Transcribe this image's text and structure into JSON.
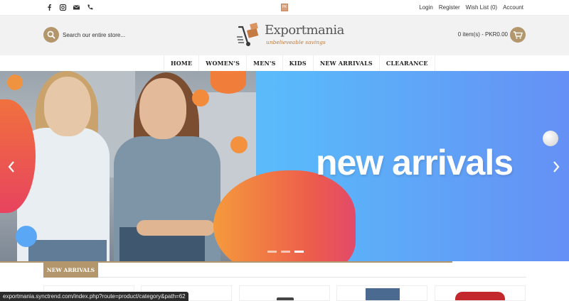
{
  "topbar": {
    "social_icons": [
      "facebook-icon",
      "instagram-icon",
      "email-icon",
      "phone-icon"
    ],
    "links": [
      "Login",
      "Register",
      "Wish List (0)",
      "Account"
    ]
  },
  "header": {
    "search_placeholder": "Search our entire store...",
    "logo_title": "Exportmania",
    "logo_tagline": "unbelieveable savings",
    "cart_text": "0 item(s) - PKR0.00"
  },
  "nav": {
    "items": [
      "HOME",
      "WOMEN'S",
      "MEN'S",
      "KIDS",
      "NEW ARRIVALS",
      "CLEARANCE"
    ]
  },
  "banner": {
    "headline": "new arrivals",
    "slides": 3,
    "active_slide": 3
  },
  "section": {
    "title": "NEW ARRIVALS"
  },
  "status": {
    "url": "exportmania.synctrend.com/index.php?route=product/category&path=62"
  },
  "colors": {
    "accent": "#b3966b",
    "banner_blue": "#5ab9fa",
    "blob_orange": "#f28a4b"
  }
}
